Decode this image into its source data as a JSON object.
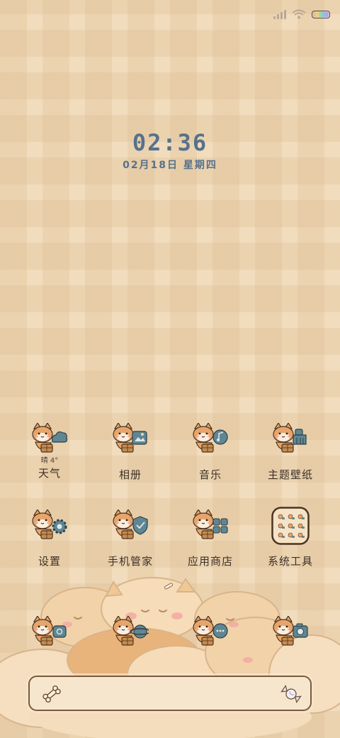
{
  "clock": {
    "time": "02:36",
    "date": "02月18日  星期四"
  },
  "status_bar": {
    "signal_icon": "signal-icon",
    "wifi_icon": "wifi-icon",
    "battery_icon": "battery-icon"
  },
  "weather": {
    "text": "晴 4°"
  },
  "row1": [
    {
      "label": "天气",
      "icon": "shiba-cloud-icon"
    },
    {
      "label": "相册",
      "icon": "shiba-photo-icon"
    },
    {
      "label": "音乐",
      "icon": "shiba-music-icon"
    },
    {
      "label": "主题壁纸",
      "icon": "shiba-brush-icon"
    }
  ],
  "row2": [
    {
      "label": "设置",
      "icon": "shiba-gear-icon"
    },
    {
      "label": "手机管家",
      "icon": "shiba-shield-icon"
    },
    {
      "label": "应用商店",
      "icon": "shiba-store-icon"
    },
    {
      "label": "系统工具",
      "icon": "folder-icon"
    }
  ],
  "dock": [
    {
      "icon": "shiba-phone-icon"
    },
    {
      "icon": "shiba-planet-icon"
    },
    {
      "icon": "shiba-message-icon"
    },
    {
      "icon": "shiba-camera-icon"
    }
  ],
  "colors": {
    "background": "#f1dcbd",
    "clock": "#57718a",
    "label": "#3d3128",
    "accent_blue": "#5f8793",
    "shiba_orange": "#e7a56a"
  }
}
